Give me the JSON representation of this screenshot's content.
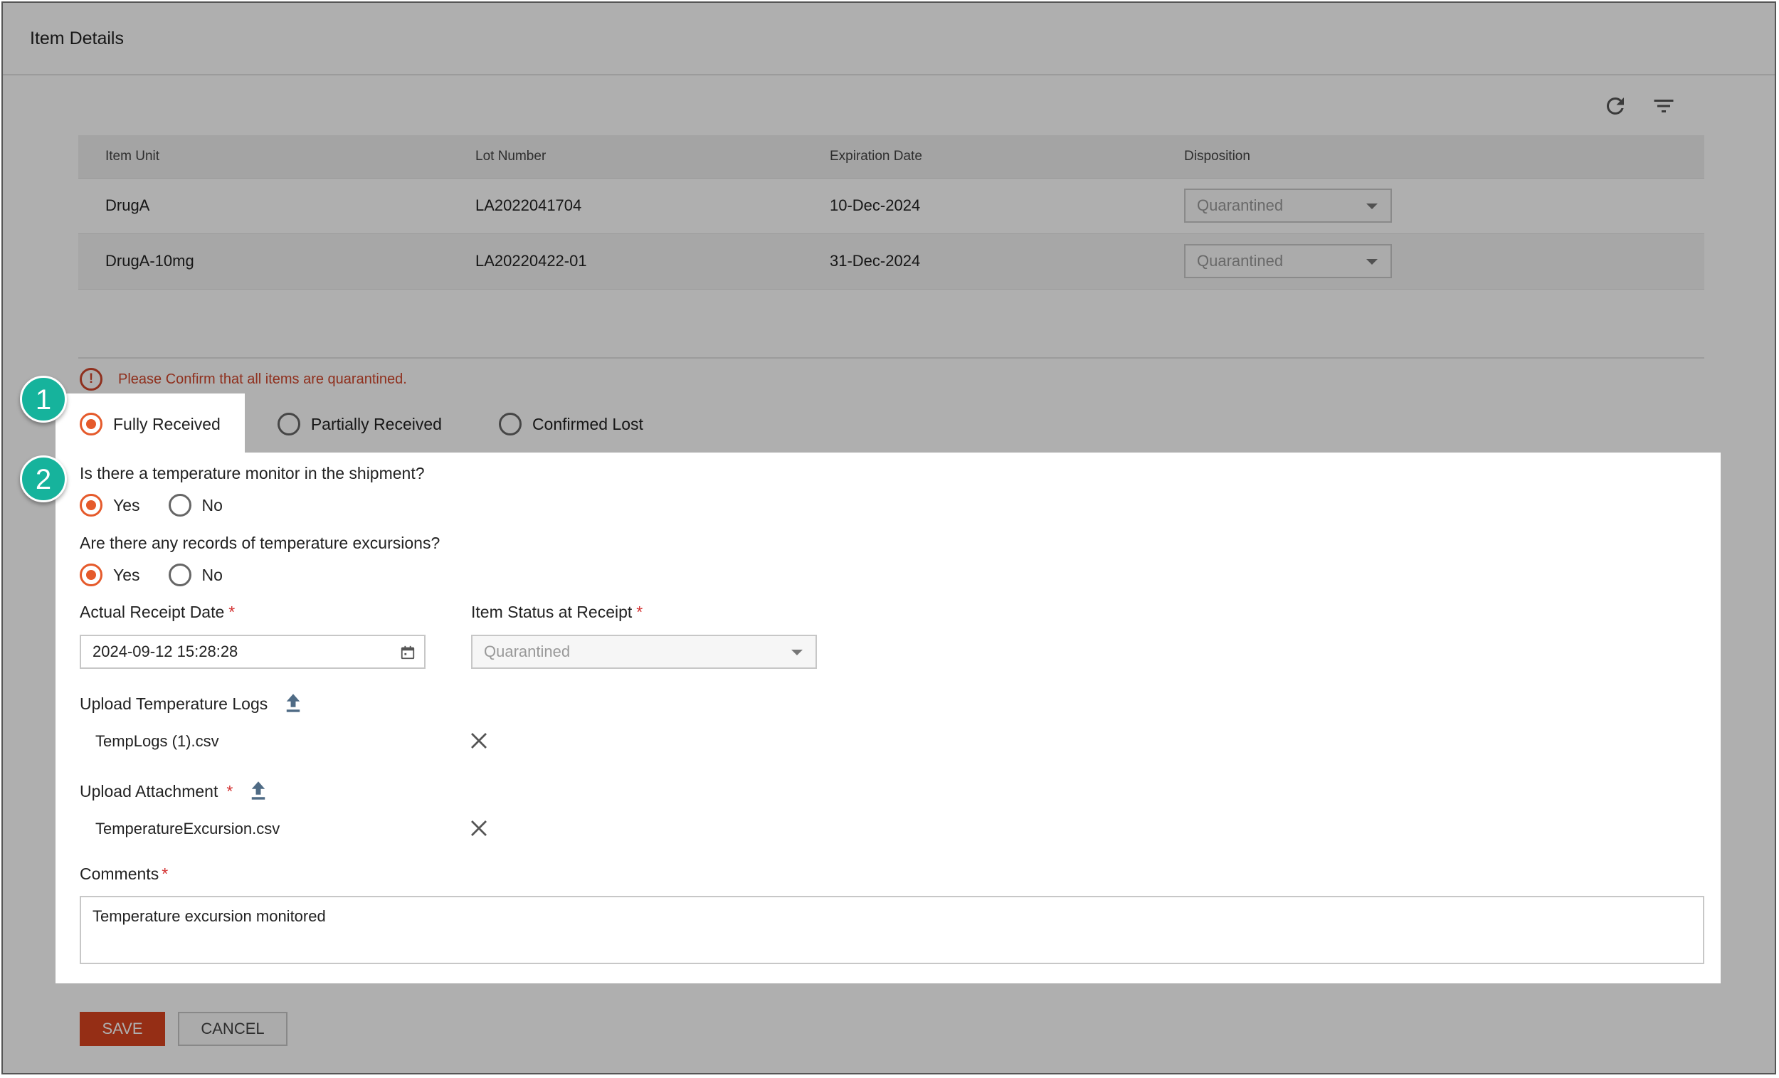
{
  "header": {
    "title": "Item Details"
  },
  "toolbar": {
    "refresh_icon": "refresh-icon",
    "filter_icon": "filter-icon"
  },
  "table": {
    "columns": [
      "Item Unit",
      "Lot Number",
      "Expiration Date",
      "Disposition"
    ],
    "rows": [
      {
        "item_unit": "DrugA",
        "lot_number": "LA2022041704",
        "expiration_date": "10-Dec-2024",
        "disposition": "Quarantined"
      },
      {
        "item_unit": "DrugA-10mg",
        "lot_number": "LA20220422-01",
        "expiration_date": "31-Dec-2024",
        "disposition": "Quarantined"
      }
    ]
  },
  "warning": {
    "text": "Please Confirm that all items are quarantined."
  },
  "receipt_options": {
    "options": [
      "Fully Received",
      "Partially Received",
      "Confirmed Lost"
    ],
    "selected": "Fully Received"
  },
  "form": {
    "temp_monitor_question": "Is there a temperature monitor in the shipment?",
    "temp_monitor_answer": "Yes",
    "excursion_question": "Are there any records of temperature excursions?",
    "excursion_answer": "Yes",
    "yes_label": "Yes",
    "no_label": "No",
    "receipt_date_label": "Actual Receipt Date",
    "receipt_date_value": "2024-09-12 15:28:28",
    "item_status_label": "Item Status at Receipt",
    "item_status_value": "Quarantined",
    "required_mark": "*",
    "upload_temp_logs_label": "Upload Temperature Logs",
    "temp_logs_file": "TempLogs (1).csv",
    "upload_attachment_label": "Upload Attachment",
    "attachment_file": "TemperatureExcursion.csv",
    "comments_label": "Comments",
    "comments_value": "Temperature excursion monitored"
  },
  "actions": {
    "save_label": "SAVE",
    "cancel_label": "CANCEL"
  },
  "callouts": {
    "badge_1": "1",
    "badge_2": "2"
  },
  "colors": {
    "accent": "#e55a2b",
    "save_button": "#d9441f",
    "badge": "#16b39c",
    "warning": "#d0472d"
  }
}
